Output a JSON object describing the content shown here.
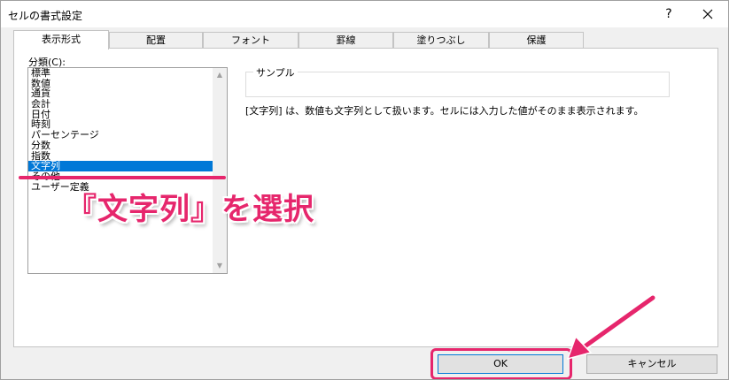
{
  "dialog": {
    "title": "セルの書式設定",
    "help_label": "?",
    "close_icon": "close-icon"
  },
  "tabs": [
    {
      "label": "表示形式",
      "active": true
    },
    {
      "label": "配置"
    },
    {
      "label": "フォント"
    },
    {
      "label": "罫線"
    },
    {
      "label": "塗りつぶし"
    },
    {
      "label": "保護"
    }
  ],
  "category": {
    "label": "分類(C):",
    "items": [
      "標準",
      "数値",
      "通貨",
      "会計",
      "日付",
      "時刻",
      "パーセンテージ",
      "分数",
      "指数",
      "文字列",
      "その他",
      "ユーザー定義"
    ],
    "selected": "文字列"
  },
  "sample": {
    "legend": "サンプル",
    "value": ""
  },
  "description": "[文字列] は、数値も文字列として扱います。セルには入力した値がそのまま表示されます。",
  "buttons": {
    "ok": "OK",
    "cancel": "キャンセル"
  },
  "annotation": {
    "text": "『文字列』を選択",
    "color": "#e6266c"
  },
  "colors": {
    "selection": "#0078d7",
    "accent": "#e6266c"
  }
}
